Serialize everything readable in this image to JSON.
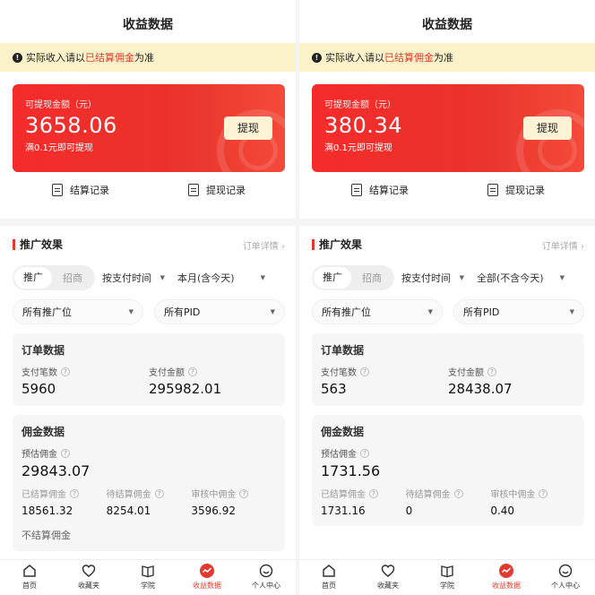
{
  "left": {
    "header": {
      "title": "收益数据"
    },
    "notice": {
      "pre": "实际收入请以",
      "highlight": "已结算佣金",
      "post": "为准"
    },
    "withdraw": {
      "label": "可提现金额（元）",
      "amount": "3658.06",
      "min_note": "满0.1元即可提现",
      "button": "提现"
    },
    "records": {
      "settle": "结算记录",
      "withdraw": "提现记录"
    },
    "promo": {
      "title": "推广效果",
      "detail": "订单详情 ›"
    },
    "filters": {
      "seg_on": "推广",
      "seg_off": "招商",
      "time_type": "按支付时间",
      "period": "本月(含今天)",
      "position": "所有推广位",
      "pid": "所有PID"
    },
    "order": {
      "title": "订单数据",
      "count_label": "支付笔数",
      "count": "5960",
      "amount_label": "支付金额",
      "amount": "295982.01"
    },
    "commission": {
      "title": "佣金数据",
      "est_label": "预估佣金",
      "est": "29843.07",
      "settled_label": "已结算佣金",
      "settled": "18561.32",
      "pending_label": "待结算佣金",
      "pending": "8254.01",
      "review_label": "审核中佣金",
      "review": "3596.92"
    },
    "peek": "不结算佣金"
  },
  "right": {
    "header": {
      "title": "收益数据"
    },
    "notice": {
      "pre": "实际收入请以",
      "highlight": "已结算佣金",
      "post": "为准"
    },
    "withdraw": {
      "label": "可提现金额（元）",
      "amount": "380.34",
      "min_note": "满0.1元即可提现",
      "button": "提现"
    },
    "records": {
      "settle": "结算记录",
      "withdraw": "提现记录"
    },
    "promo": {
      "title": "推广效果",
      "detail": "订单详情 ›"
    },
    "filters": {
      "seg_on": "推广",
      "seg_off": "招商",
      "time_type": "按支付时间",
      "period": "全部(不含今天)",
      "position": "所有推广位",
      "pid": "所有PID"
    },
    "order": {
      "title": "订单数据",
      "count_label": "支付笔数",
      "count": "563",
      "amount_label": "支付金额",
      "amount": "28438.07"
    },
    "commission": {
      "title": "佣金数据",
      "est_label": "预估佣金",
      "est": "1731.56",
      "settled_label": "已结算佣金",
      "settled": "1731.16",
      "pending_label": "待结算佣金",
      "pending": "0",
      "review_label": "审核中佣金",
      "review": "0.40"
    }
  },
  "tabs": [
    {
      "label": "首页",
      "icon": "home-icon"
    },
    {
      "label": "收藏夹",
      "icon": "heart-icon"
    },
    {
      "label": "学院",
      "icon": "book-icon"
    },
    {
      "label": "收益数据",
      "icon": "earnings-icon"
    },
    {
      "label": "个人中心",
      "icon": "smile-icon"
    }
  ],
  "colors": {
    "accent": "#e23a2e",
    "notice_bg": "#fbf2c9",
    "card_red": "#f52b2b"
  }
}
